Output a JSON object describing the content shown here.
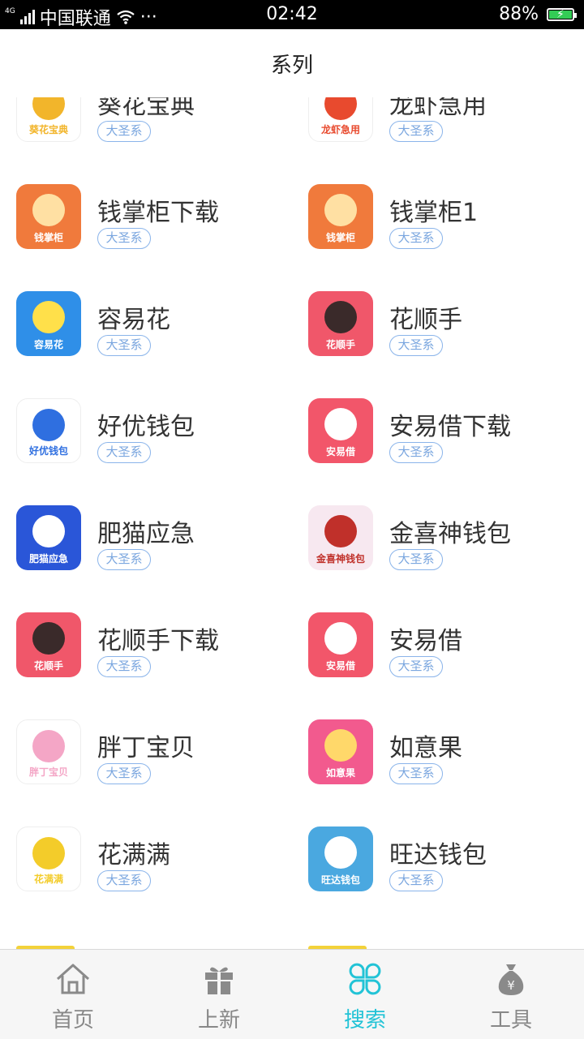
{
  "status": {
    "network": "4G",
    "carrier": "中国联通",
    "more": "···",
    "time": "02:42",
    "battery": "88%"
  },
  "header": {
    "title": "系列"
  },
  "apps": [
    {
      "name": "葵花宝典",
      "tag": "大圣系",
      "icon_caption": "葵花宝典",
      "icon_color": "#ffffff",
      "accent": "#f2b52b"
    },
    {
      "name": "龙虾急用",
      "tag": "大圣系",
      "icon_caption": "龙虾急用",
      "icon_color": "#ffffff",
      "accent": "#e84a2e"
    },
    {
      "name": "钱掌柜下载",
      "tag": "大圣系",
      "icon_caption": "钱掌柜",
      "icon_color": "#f07a3c",
      "accent": "#ffe0a3"
    },
    {
      "name": "钱掌柜1",
      "tag": "大圣系",
      "icon_caption": "钱掌柜",
      "icon_color": "#f07a3c",
      "accent": "#ffe0a3"
    },
    {
      "name": "容易花",
      "tag": "大圣系",
      "icon_caption": "容易花",
      "icon_color": "#2f8fe8",
      "accent": "#ffe04a"
    },
    {
      "name": "花顺手",
      "tag": "大圣系",
      "icon_caption": "花顺手",
      "icon_color": "#f0576a",
      "accent": "#3a2a2a"
    },
    {
      "name": "好优钱包",
      "tag": "大圣系",
      "icon_caption": "好优钱包",
      "icon_color": "#ffffff",
      "accent": "#2f6fe0"
    },
    {
      "name": "安易借下载",
      "tag": "大圣系",
      "icon_caption": "安易借",
      "icon_color": "#f2566a",
      "accent": "#ffffff"
    },
    {
      "name": "肥猫应急",
      "tag": "大圣系",
      "icon_caption": "肥猫应急",
      "icon_color": "#2a56d8",
      "accent": "#ffffff"
    },
    {
      "name": "金喜神钱包",
      "tag": "大圣系",
      "icon_caption": "金喜神钱包",
      "icon_color": "#f7e8f0",
      "accent": "#c0302a"
    },
    {
      "name": "花顺手下载",
      "tag": "大圣系",
      "icon_caption": "花顺手",
      "icon_color": "#f0576a",
      "accent": "#3a2a2a"
    },
    {
      "name": "安易借",
      "tag": "大圣系",
      "icon_caption": "安易借",
      "icon_color": "#f2566a",
      "accent": "#ffffff"
    },
    {
      "name": "胖丁宝贝",
      "tag": "大圣系",
      "icon_caption": "胖丁宝贝",
      "icon_color": "#ffffff",
      "accent": "#f4a6c6"
    },
    {
      "name": "如意果",
      "tag": "大圣系",
      "icon_caption": "如意果",
      "icon_color": "#f25a8e",
      "accent": "#ffd86a"
    },
    {
      "name": "花满满",
      "tag": "大圣系",
      "icon_caption": "花满满",
      "icon_color": "#ffffff",
      "accent": "#f3cc2a"
    },
    {
      "name": "旺达钱包",
      "tag": "大圣系",
      "icon_caption": "旺达钱包",
      "icon_color": "#4aa8e0",
      "accent": "#ffffff"
    }
  ],
  "tabs": [
    {
      "label": "首页",
      "icon": "home-icon",
      "active": false
    },
    {
      "label": "上新",
      "icon": "gift-icon",
      "active": false
    },
    {
      "label": "搜索",
      "icon": "clover-icon",
      "active": true
    },
    {
      "label": "工具",
      "icon": "money-bag-icon",
      "active": false
    }
  ]
}
